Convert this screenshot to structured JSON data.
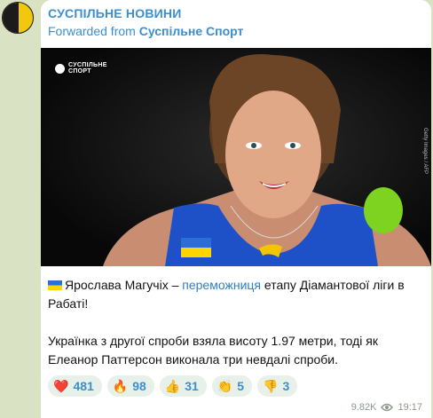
{
  "channel": {
    "name": "СУСПІЛЬНЕ НОВИНИ"
  },
  "forwarded": {
    "prefix": "Forwarded from",
    "source": "Суспільне Спорт"
  },
  "photo": {
    "logo_line1": "СУСПІЛЬНЕ",
    "logo_line2": "СПОРТ",
    "credit": "Getty Images / AFP"
  },
  "message": {
    "headline_part1": "Ярослава Магучіх –",
    "headline_link": "переможниця",
    "headline_part2": "етапу Діамантової ліги в Рабаті!",
    "body": "Українка з другої спроби взяла висоту 1.97 метри, тоді як Елеанор Паттерсон виконала три невдалі спроби."
  },
  "reactions": [
    {
      "emoji": "❤️",
      "count": "481"
    },
    {
      "emoji": "🔥",
      "count": "98"
    },
    {
      "emoji": "👍",
      "count": "31"
    },
    {
      "emoji": "👏",
      "count": "5"
    },
    {
      "emoji": "👎",
      "count": "3"
    }
  ],
  "meta": {
    "views": "9.82K",
    "time": "19:17"
  },
  "colors": {
    "link": "#3a8fd0",
    "background": "#d9e3c4",
    "reaction_bg": "#e8f0ea"
  }
}
